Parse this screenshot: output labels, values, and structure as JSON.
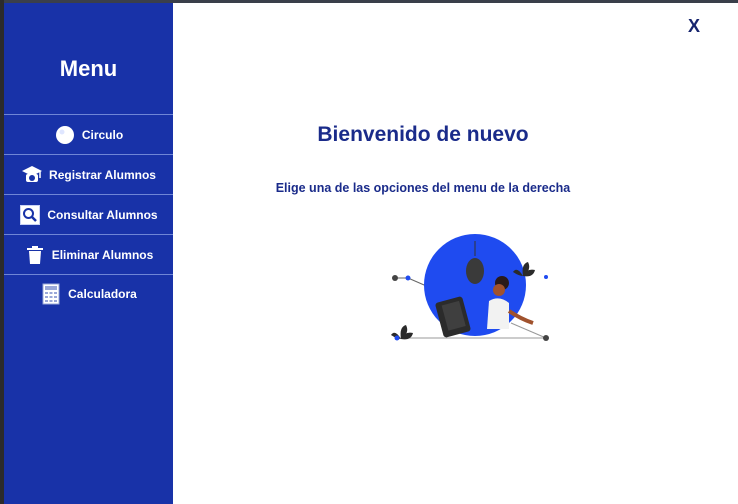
{
  "sidebar": {
    "title": "Menu",
    "items": [
      {
        "label": "Circulo",
        "icon": "circle-icon"
      },
      {
        "label": "Registrar Alumnos",
        "icon": "graduate-icon"
      },
      {
        "label": "Consultar Alumnos",
        "icon": "search-icon"
      },
      {
        "label": "Eliminar Alumnos",
        "icon": "trash-icon"
      },
      {
        "label": "Calculadora",
        "icon": "calculator-icon"
      }
    ]
  },
  "main": {
    "close_label": "X",
    "title": "Bienvenido de nuevo",
    "subtitle": "Elige una de las opciones del menu de la derecha"
  },
  "colors": {
    "sidebar_bg": "#1832a8",
    "accent_text": "#1a2b8a",
    "illustration_blue": "#1f4bf0"
  }
}
